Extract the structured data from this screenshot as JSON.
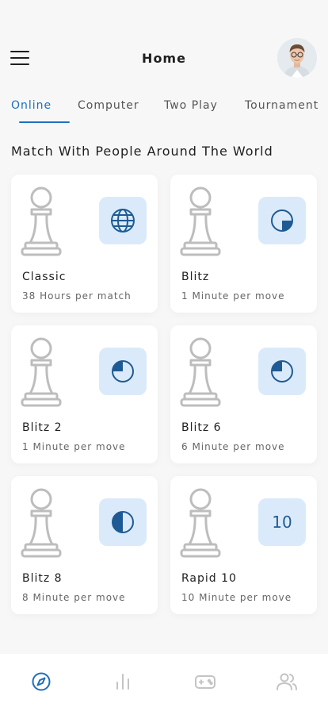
{
  "header": {
    "title": "Home",
    "menu_icon": "hamburger-icon",
    "avatar": "user-avatar"
  },
  "tabs": [
    {
      "label": "Online",
      "active": true
    },
    {
      "label": "Computer",
      "active": false
    },
    {
      "label": "Two Play",
      "active": false
    },
    {
      "label": "Tournament",
      "active": false
    }
  ],
  "section_title": "Match With People Around The World",
  "cards": [
    {
      "name": "Classic",
      "subtitle": "38 Hours per match",
      "icon": "globe-icon"
    },
    {
      "name": "Blitz",
      "subtitle": "1 Minute per move",
      "icon": "clock-quarter-icon"
    },
    {
      "name": "Blitz 2",
      "subtitle": "1 Minute per move",
      "icon": "clock-quarter-icon"
    },
    {
      "name": "Blitz 6",
      "subtitle": "6 Minute per move",
      "icon": "clock-quarter-icon"
    },
    {
      "name": "Blitz 8",
      "subtitle": "8 Minute per move",
      "icon": "clock-half-icon"
    },
    {
      "name": "Rapid 10",
      "subtitle": "10 Minute per move",
      "icon_text": "10"
    }
  ],
  "bottom_nav": [
    {
      "icon": "compass-icon",
      "active": true
    },
    {
      "icon": "stats-icon",
      "active": false
    },
    {
      "icon": "gamepad-icon",
      "active": false
    },
    {
      "icon": "users-icon",
      "active": false
    }
  ],
  "colors": {
    "accent": "#1e6fbf",
    "icon_bg": "#dbeafa",
    "icon_fg": "#1e5b94"
  }
}
